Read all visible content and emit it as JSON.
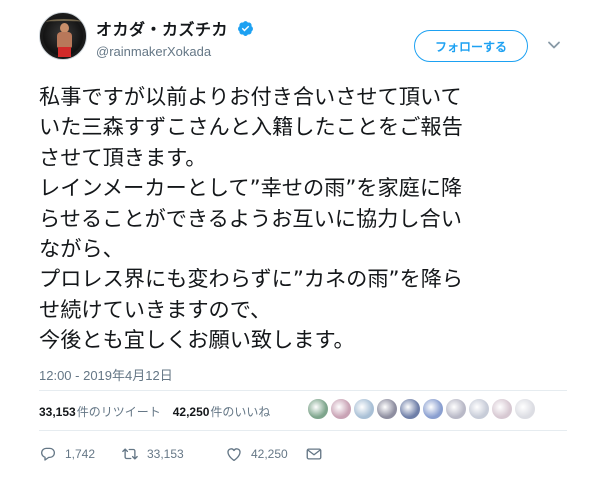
{
  "user": {
    "display_name": "オカダ・カズチカ",
    "handle": "@rainmakerXokada",
    "verified": true
  },
  "follow_button_label": "フォローする",
  "tweet": {
    "lines": [
      "私事ですが以前よりお付き合いさせて頂いて",
      "いた三森すずこさんと入籍したことをご報告",
      "させて頂きます。",
      "レインメーカーとして”幸せの雨”を家庭に降",
      "らせることができるようお互いに協力し合い",
      "ながら、",
      "プロレス界にも変わらずに”カネの雨”を降ら",
      "せ続けていきますので、",
      "今後とも宜しくお願い致します。"
    ],
    "timestamp": "12:00 - 2019年4月12日"
  },
  "stats": {
    "retweets_count": "33,153",
    "retweets_label": "件のリツイート",
    "likes_count": "42,250",
    "likes_label": "件のいいね"
  },
  "actions": {
    "replies": "1,742",
    "retweets": "33,153",
    "likes": "42,250"
  },
  "colors": {
    "accent": "#1da1f2",
    "secondary_text": "#657786",
    "divider": "#e6ecf0"
  },
  "liker_avatar_colors": [
    "#7ea58c",
    "#c9a3b5",
    "#a9c0d6",
    "#8e8ea0",
    "#6f7fa8",
    "#8a9fd0",
    "#b9b9c7",
    "#c7ccd8",
    "#d7c8d2",
    "#dcdde3"
  ]
}
